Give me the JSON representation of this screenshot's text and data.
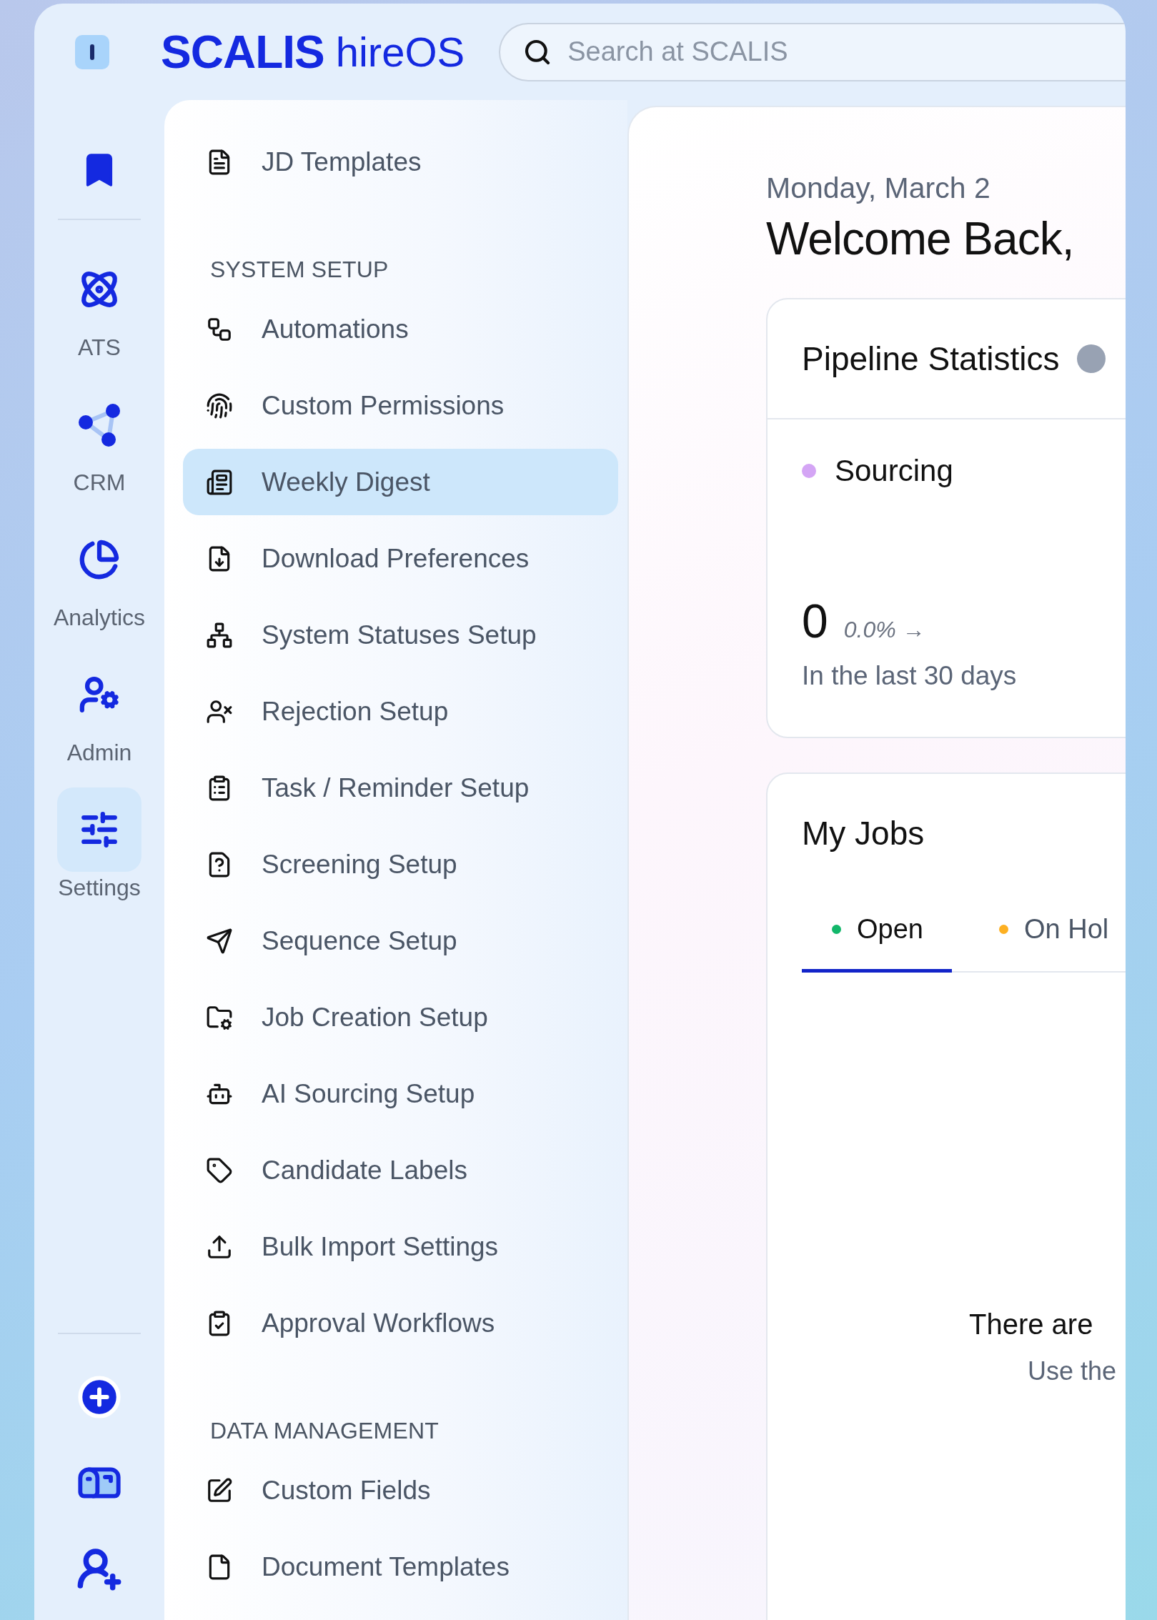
{
  "header": {
    "brand": "SCALIS",
    "product": "hireOS",
    "search": {
      "placeholder": "Search at SCALIS"
    }
  },
  "rail": {
    "items": [
      {
        "label": "ATS",
        "selected": false
      },
      {
        "label": "CRM",
        "selected": false
      },
      {
        "label": "Analytics",
        "selected": false
      },
      {
        "label": "Admin",
        "selected": false
      },
      {
        "label": "Settings",
        "selected": true
      }
    ]
  },
  "sidebar": {
    "sections": [
      {
        "items": [
          {
            "label": "JD Templates",
            "selected": false
          }
        ]
      },
      {
        "title": "SYSTEM SETUP",
        "items": [
          {
            "label": "Automations",
            "selected": false
          },
          {
            "label": "Custom Permissions",
            "selected": false
          },
          {
            "label": "Weekly Digest",
            "selected": true
          },
          {
            "label": "Download Preferences",
            "selected": false
          },
          {
            "label": "System Statuses Setup",
            "selected": false
          },
          {
            "label": "Rejection Setup",
            "selected": false
          },
          {
            "label": "Task / Reminder Setup",
            "selected": false
          },
          {
            "label": "Screening Setup",
            "selected": false
          },
          {
            "label": "Sequence Setup",
            "selected": false
          },
          {
            "label": "Job Creation Setup",
            "selected": false
          },
          {
            "label": "AI Sourcing Setup",
            "selected": false
          },
          {
            "label": "Candidate Labels",
            "selected": false
          },
          {
            "label": "Bulk Import Settings",
            "selected": false
          },
          {
            "label": "Approval Workflows",
            "selected": false
          }
        ]
      },
      {
        "title": "DATA MANAGEMENT",
        "items": [
          {
            "label": "Custom Fields",
            "selected": false
          },
          {
            "label": "Document Templates",
            "selected": false
          }
        ]
      }
    ]
  },
  "main": {
    "date": "Monday, March 2",
    "greeting": "Welcome Back,",
    "pipeline": {
      "title": "Pipeline Statistics",
      "stage": {
        "label": "Sourcing",
        "color": "#d4a5f5"
      },
      "count": "0",
      "change": "0.0% →",
      "period": "In the last 30 days"
    },
    "jobs": {
      "title": "My Jobs",
      "tabs": [
        {
          "label": "Open",
          "color": "#12b76a",
          "selected": true
        },
        {
          "label": "On Hol",
          "color": "#fdb022",
          "selected": false
        }
      ],
      "empty": {
        "title": "There are",
        "subtitle": "Use the"
      }
    }
  }
}
